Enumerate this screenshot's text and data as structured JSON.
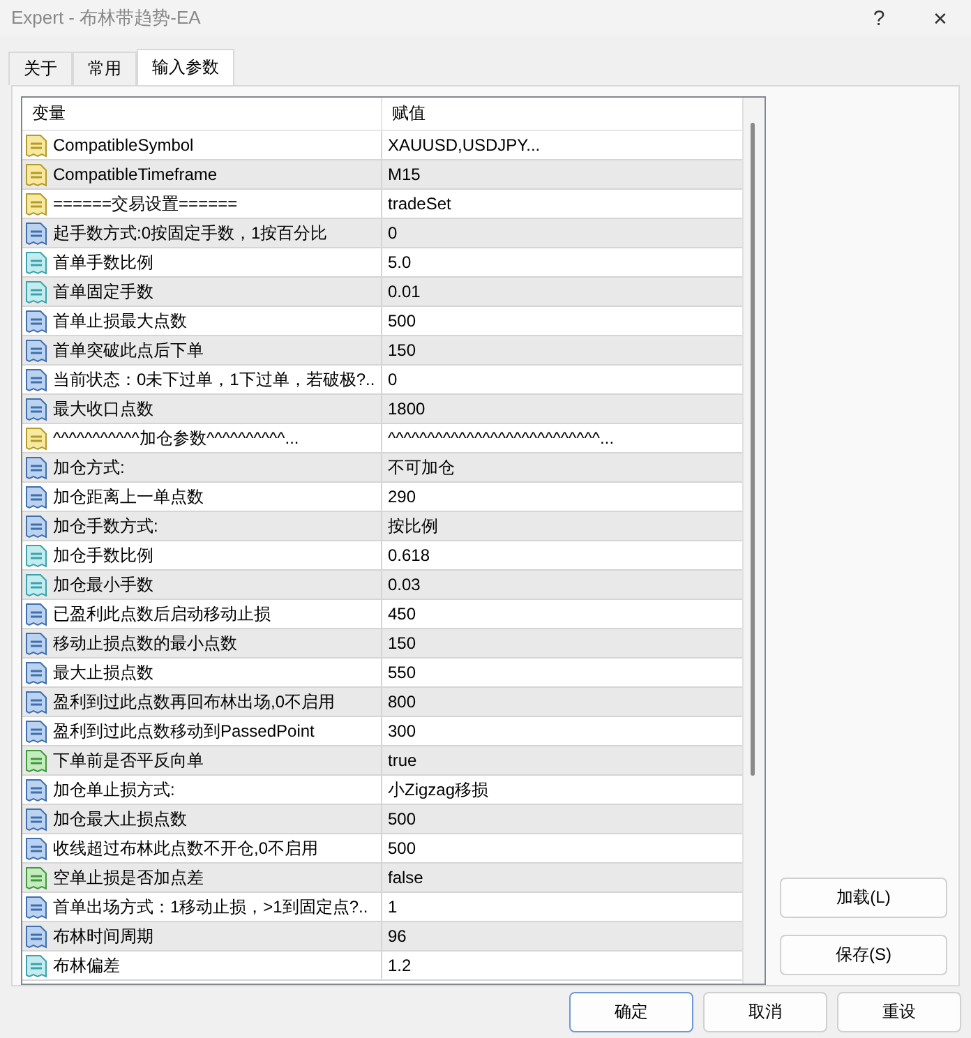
{
  "window": {
    "title": "Expert - 布林带趋势-EA",
    "controls": [
      {
        "kind": "help",
        "label": "?"
      },
      {
        "kind": "close",
        "label": "✕"
      }
    ]
  },
  "tabs": [
    {
      "label": "关于",
      "selected": false
    },
    {
      "label": "常用",
      "selected": false
    },
    {
      "label": "输入参数",
      "selected": true
    }
  ],
  "table": {
    "columns": [
      "变量",
      "赋值"
    ],
    "rows": [
      {
        "kind": "string",
        "name": "CompatibleSymbol",
        "value": "XAUUSD,USDJPY..."
      },
      {
        "kind": "string",
        "name": "CompatibleTimeframe",
        "value": "M15"
      },
      {
        "kind": "string",
        "name": "======交易设置======",
        "value": "tradeSet"
      },
      {
        "kind": "int",
        "name": "起手数方式:0按固定手数，1按百分比",
        "value": "0"
      },
      {
        "kind": "double",
        "name": "首单手数比例",
        "value": "5.0"
      },
      {
        "kind": "double",
        "name": "首单固定手数",
        "value": "0.01"
      },
      {
        "kind": "int",
        "name": "首单止损最大点数",
        "value": "500"
      },
      {
        "kind": "int",
        "name": "首单突破此点后下单",
        "value": "150"
      },
      {
        "kind": "int",
        "name": "当前状态：0未下过单，1下过单，若破极?..",
        "value": "0"
      },
      {
        "kind": "int",
        "name": "最大收口点数",
        "value": "1800"
      },
      {
        "kind": "string",
        "name": "^^^^^^^^^^^加仓参数^^^^^^^^^^...",
        "value": "^^^^^^^^^^^^^^^^^^^^^^^^^^^..."
      },
      {
        "kind": "int",
        "name": "加仓方式:",
        "value": "不可加仓"
      },
      {
        "kind": "int",
        "name": "加仓距离上一单点数",
        "value": "290"
      },
      {
        "kind": "int",
        "name": "加仓手数方式:",
        "value": "按比例"
      },
      {
        "kind": "double",
        "name": "加仓手数比例",
        "value": "0.618"
      },
      {
        "kind": "double",
        "name": "加仓最小手数",
        "value": "0.03"
      },
      {
        "kind": "int",
        "name": "已盈利此点数后启动移动止损",
        "value": "450"
      },
      {
        "kind": "int",
        "name": "移动止损点数的最小点数",
        "value": "150"
      },
      {
        "kind": "int",
        "name": "最大止损点数",
        "value": "550"
      },
      {
        "kind": "int",
        "name": "盈利到过此点数再回布林出场,0不启用",
        "value": "800"
      },
      {
        "kind": "int",
        "name": "盈利到过此点数移动到PassedPoint",
        "value": "300"
      },
      {
        "kind": "bool",
        "name": "下单前是否平反向单",
        "value": "true"
      },
      {
        "kind": "int",
        "name": "加仓单止损方式:",
        "value": "小Zigzag移损"
      },
      {
        "kind": "int",
        "name": "加仓最大止损点数",
        "value": "500"
      },
      {
        "kind": "int",
        "name": "收线超过布林此点数不开仓,0不启用",
        "value": "500"
      },
      {
        "kind": "bool",
        "name": "空单止损是否加点差",
        "value": "false"
      },
      {
        "kind": "int",
        "name": "首单出场方式：1移动止损，>1到固定点?..",
        "value": "1"
      },
      {
        "kind": "int",
        "name": "布林时间周期",
        "value": "96"
      },
      {
        "kind": "double",
        "name": "布林偏差",
        "value": "1.2"
      }
    ]
  },
  "side_buttons": [
    "加载(L)",
    "保存(S)"
  ],
  "footer_buttons": [
    "确定",
    "取消",
    "重设"
  ]
}
